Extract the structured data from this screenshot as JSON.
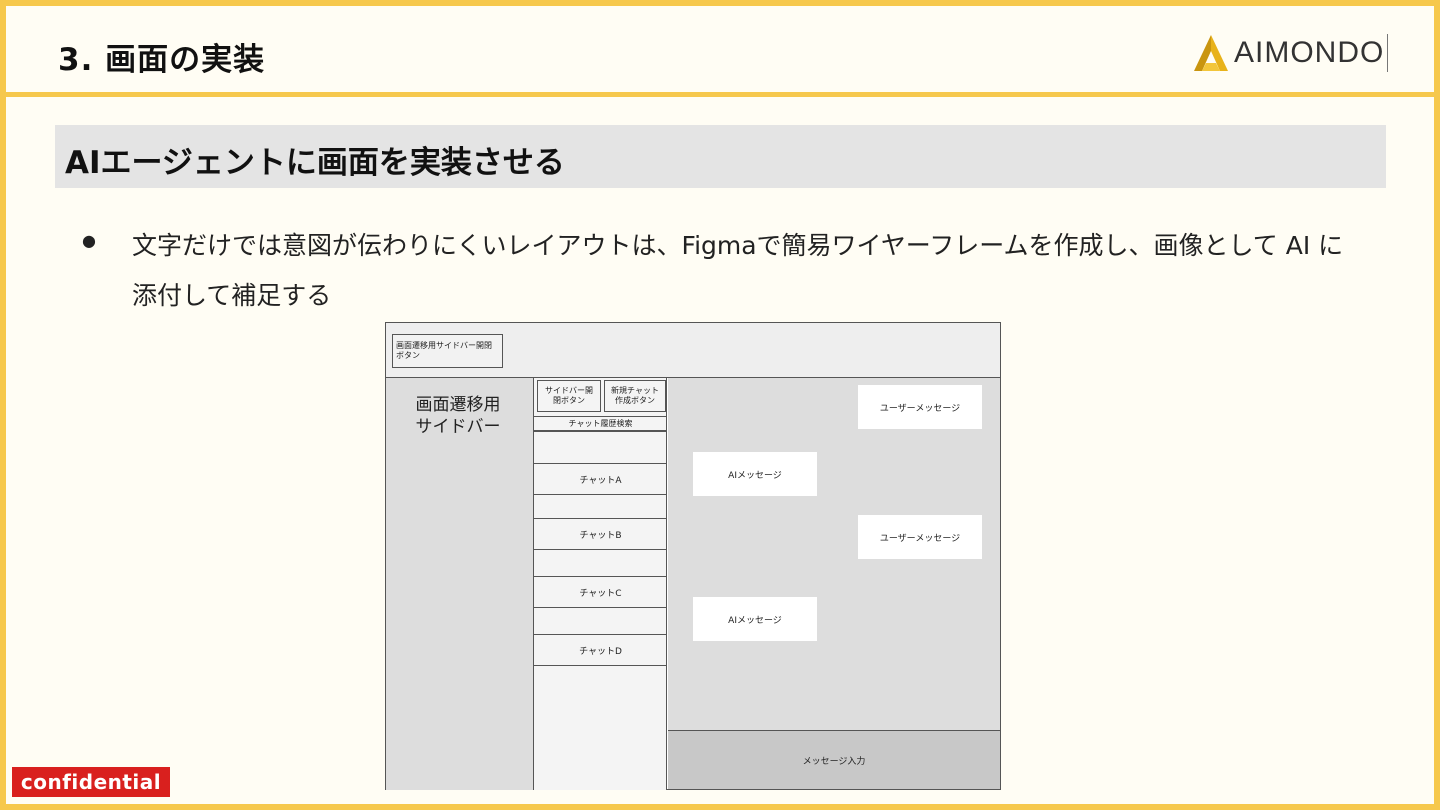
{
  "header": {
    "title": "3.  画面の実装",
    "logo_text": "AIMONDO",
    "logo_color": "#e8b21a"
  },
  "section": {
    "title": "AIエージェントに画面を実装させる"
  },
  "bullet": {
    "marker": "●",
    "text": "文字だけでは意図が伝わりにくいレイアウトは、Figmaで簡易ワイヤーフレームを作成し、画像として AI に添付して補足する"
  },
  "wireframe": {
    "top_button": "画面遷移用サイドバー開閉ボタン",
    "nav_sidebar": "画面遷移用サイドバー",
    "sidebar_toggle": "サイドバー開閉ボタン",
    "new_chat": "新規チャット作成ボタン",
    "search": "チャット履歴検索",
    "chats": [
      "チャットA",
      "チャットB",
      "チャットC",
      "チャットD"
    ],
    "user_message": "ユーザーメッセージ",
    "ai_message": "AIメッセージ",
    "input": "メッセージ入力"
  },
  "footer": {
    "confidential": "confidential"
  },
  "colors": {
    "frame": "#f6c84c",
    "background": "#fffdf4",
    "section_bar": "#e4e4e4",
    "confidential_bg": "#d9201e"
  }
}
